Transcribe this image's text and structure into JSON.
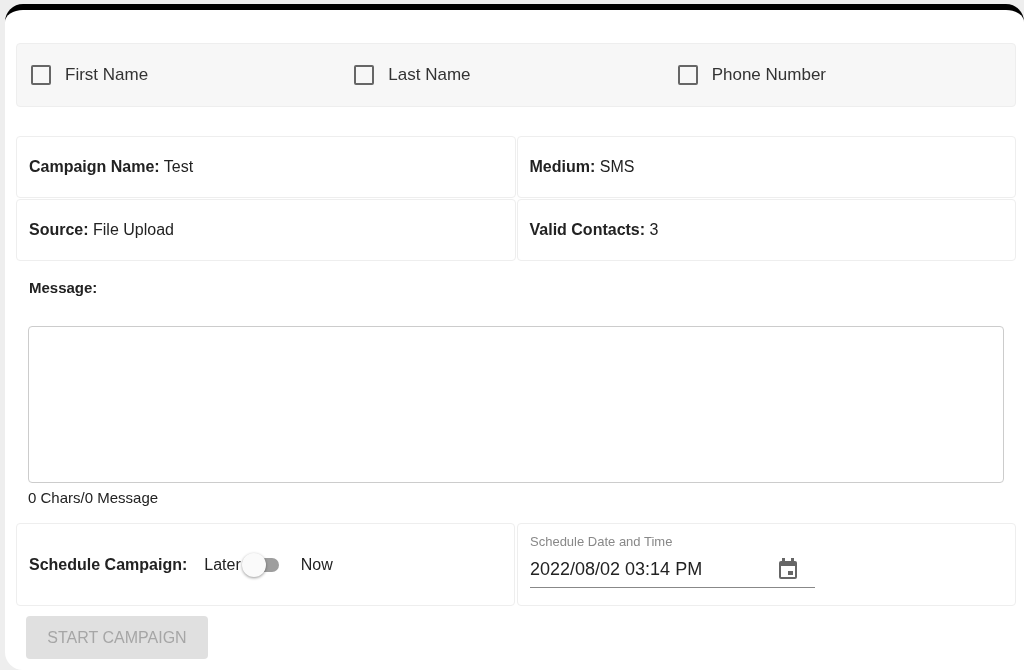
{
  "fields": [
    {
      "label": "First Name",
      "checked": false
    },
    {
      "label": "Last Name",
      "checked": false
    },
    {
      "label": "Phone Number",
      "checked": false
    }
  ],
  "details": [
    {
      "label": "Campaign Name:",
      "value": "Test"
    },
    {
      "label": "Medium:",
      "value": "SMS"
    },
    {
      "label": "Source:",
      "value": "File Upload"
    },
    {
      "label": "Valid Contacts:",
      "value": "3"
    }
  ],
  "message": {
    "label": "Message:",
    "counter": "0 Chars/0 Message"
  },
  "schedule": {
    "label": "Schedule Campaign:",
    "off_label": "Later",
    "on_label": "Now",
    "on": false
  },
  "datetime": {
    "label": "Schedule Date and Time",
    "value": "2022/08/02 03:14 PM"
  },
  "start_button": {
    "label": "START CAMPAIGN",
    "disabled": true
  }
}
